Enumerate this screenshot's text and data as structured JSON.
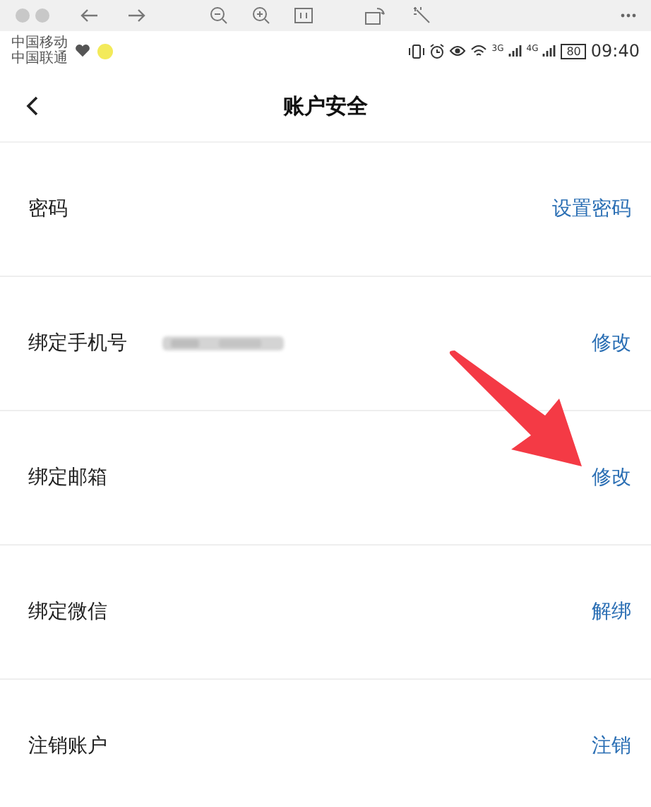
{
  "status_bar": {
    "carriers": [
      "中国移动",
      "中国联通"
    ],
    "network_2": "3G",
    "network_1": "4G",
    "battery": "80",
    "time": "09:40"
  },
  "header": {
    "title": "账户安全"
  },
  "rows": [
    {
      "label": "密码",
      "value_hidden": false,
      "action": "设置密码"
    },
    {
      "label": "绑定手机号",
      "value_hidden": true,
      "action": "修改"
    },
    {
      "label": "绑定邮箱",
      "value_hidden": false,
      "action": "修改"
    },
    {
      "label": "绑定微信",
      "value_hidden": false,
      "action": "解绑"
    },
    {
      "label": "注销账户",
      "value_hidden": false,
      "action": "注销"
    }
  ]
}
